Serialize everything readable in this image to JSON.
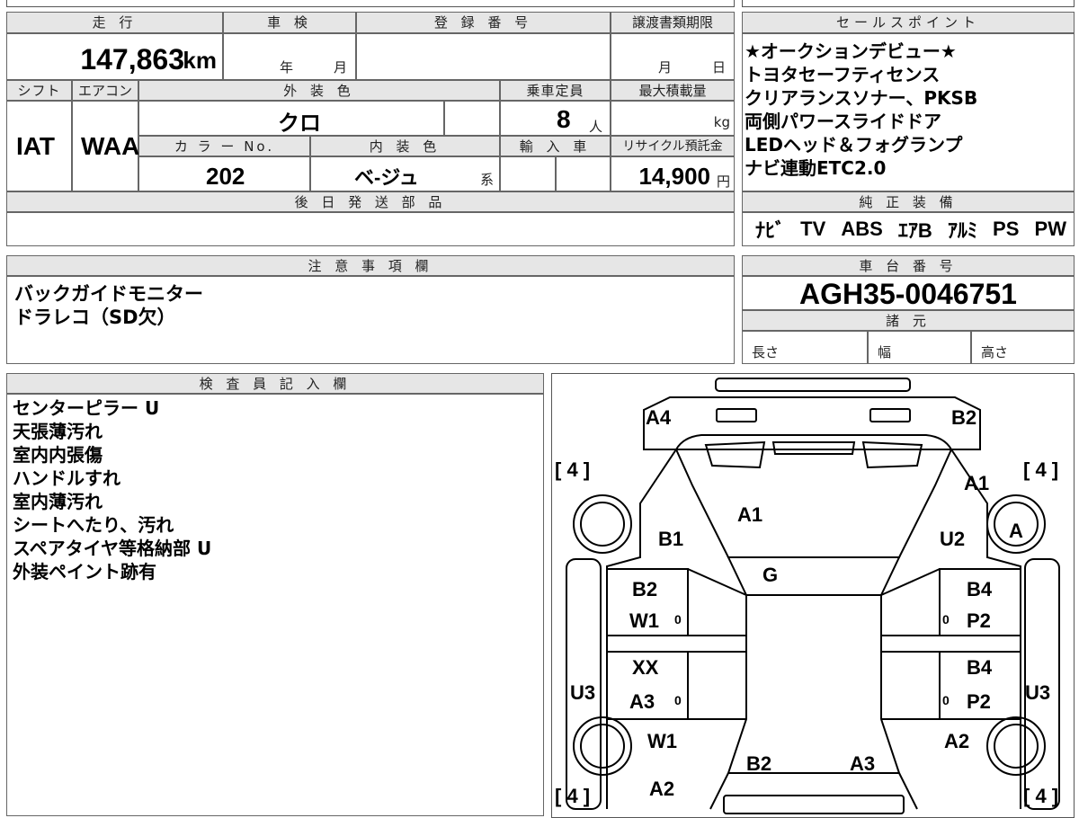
{
  "header": {
    "mileage_label": "走 行",
    "inspection_label": "車 検",
    "registration_label": "登 録 番 号",
    "transfer_deadline_label": "譲渡書類期限",
    "sales_points_label": "セールスポイント",
    "mileage_value": "147,863",
    "mileage_unit": "km",
    "inspection_year_unit": "年",
    "inspection_month_unit": "月",
    "transfer_month_unit": "月",
    "transfer_day_unit": "日"
  },
  "spec": {
    "shift_label": "シフト",
    "aircon_label": "エアコン",
    "exterior_color_label": "外 装 色",
    "capacity_label": "乗車定員",
    "max_load_label": "最大積載量",
    "shift_value": "IAT",
    "aircon_value": "WAA",
    "exterior_color_value": "クロ",
    "capacity_value": "8",
    "capacity_unit": "人",
    "max_load_unit": "kg",
    "color_no_label": "カ ラ ー No.",
    "interior_color_label": "内 装 色",
    "import_label": "輸 入 車",
    "recycle_label": "リサイクル預託金",
    "color_no_value": "202",
    "interior_color_value": "ベ-ジュ",
    "interior_color_suffix": "系",
    "recycle_value": "14,900",
    "recycle_unit": "円"
  },
  "sales_points": [
    "★オークションデビュー★",
    "トヨタセーフティセンス",
    "クリアランスソナー、PKSB",
    "両側パワースライドドア",
    "LEDヘッド＆フォグランプ",
    "ナビ連動ETC2.0"
  ],
  "later_parts": {
    "label": "後 日 発 送 部 品"
  },
  "genuine_equipment": {
    "label": "純 正 装 備",
    "items": [
      "ﾅﾋﾞ",
      "TV",
      "ABS",
      "ｴｱB",
      "ｱﾙﾐ",
      "PS",
      "PW"
    ]
  },
  "notes": {
    "label": "注 意 事 項 欄",
    "lines": [
      "バックガイドモニター",
      "ドラレコ（SD欠）"
    ]
  },
  "chassis": {
    "label": "車 台 番 号",
    "value": "AGH35-0046751",
    "specs_label": "諸 元",
    "length_label": "長さ",
    "width_label": "幅",
    "height_label": "高さ"
  },
  "inspector": {
    "label": "検 査 員 記 入 欄",
    "lines": [
      "センターピラー U",
      "天張薄汚れ",
      "室内内張傷",
      "ハンドルすれ",
      "室内薄汚れ",
      "シートへたり、汚れ",
      "スペアタイヤ等格納部 U",
      "外装ペイント跡有"
    ]
  },
  "diagram": {
    "tire_marks": [
      "[ 4 ]",
      "[ 4 ]",
      "[ 4 ]",
      "[ 4 ]"
    ],
    "codes": {
      "front_left": "A4",
      "front_right": "B2",
      "fender_left_top": "B1",
      "hood": "A1",
      "fender_right_top": "A1",
      "fender_right_u": "U2",
      "right_circle": "A",
      "windshield": "G",
      "left_front_door_1": "B2",
      "left_front_door_2": "W1",
      "right_front_door_1": "B4",
      "right_front_door_2": "P2",
      "left_rear_door_1": "XX",
      "left_rear_door_2": "A3",
      "right_rear_door_1": "B4",
      "right_rear_door_2": "P2",
      "left_sill": "U3",
      "right_sill": "U3",
      "left_rear_fender": "W1",
      "right_rear_fender": "A2",
      "roof_rear_left": "B2",
      "roof_rear_right": "A3",
      "rear_left": "A2"
    },
    "zeros": [
      "0",
      "0",
      "0",
      "0"
    ]
  }
}
